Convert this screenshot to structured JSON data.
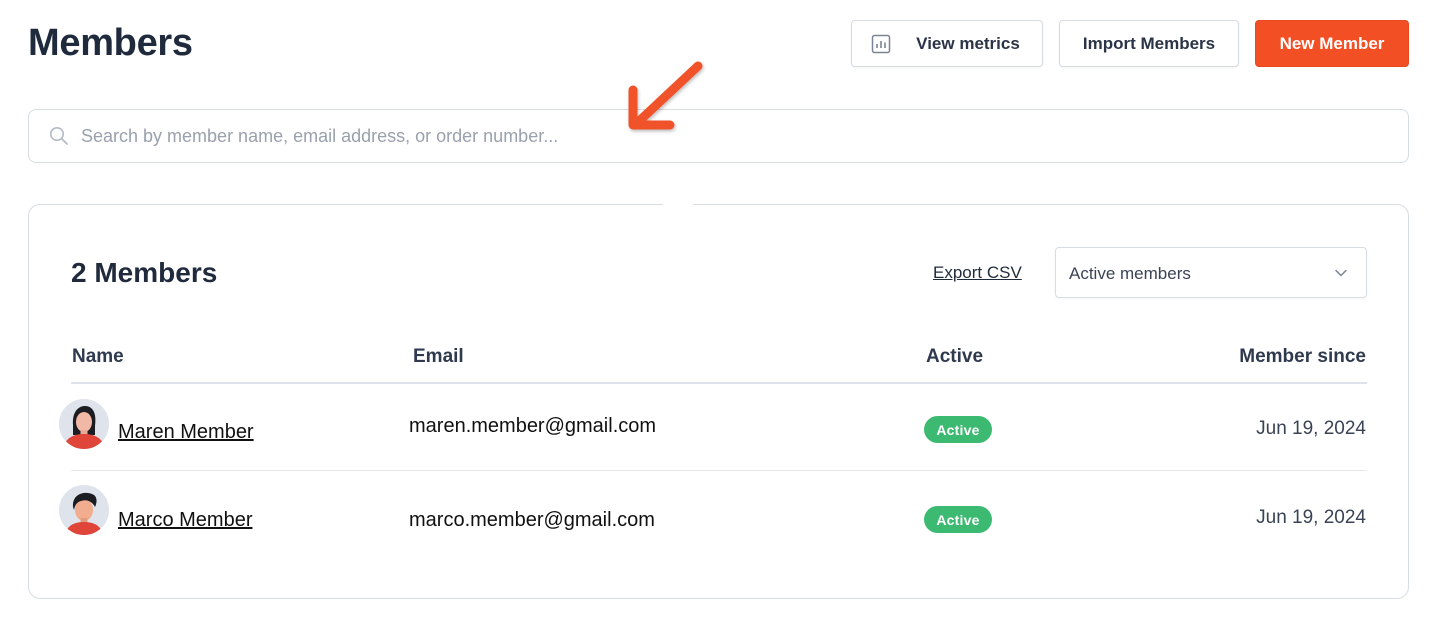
{
  "header": {
    "title": "Members",
    "view_metrics_label": "View metrics",
    "import_label": "Import Members",
    "new_member_label": "New Member"
  },
  "search": {
    "placeholder": "Search by member name, email address, or order number..."
  },
  "members_card": {
    "count_title": "2 Members",
    "export_label": "Export CSV",
    "filter_value": "Active members",
    "columns": [
      "Name",
      "Email",
      "Active",
      "Member since"
    ],
    "rows": [
      {
        "name": "Maren Member",
        "email": "maren.member@gmail.com",
        "status": "Active",
        "since": "Jun 19, 2024"
      },
      {
        "name": "Marco Member",
        "email": "marco.member@gmail.com",
        "status": "Active",
        "since": "Jun 19, 2024"
      }
    ]
  },
  "colors": {
    "accent": "#f24f25",
    "active_badge": "#3dba72",
    "text": "#1f2a3c"
  },
  "icons": [
    "chart-icon",
    "search-icon",
    "chevron-down-icon",
    "arrow-annotation-icon"
  ]
}
